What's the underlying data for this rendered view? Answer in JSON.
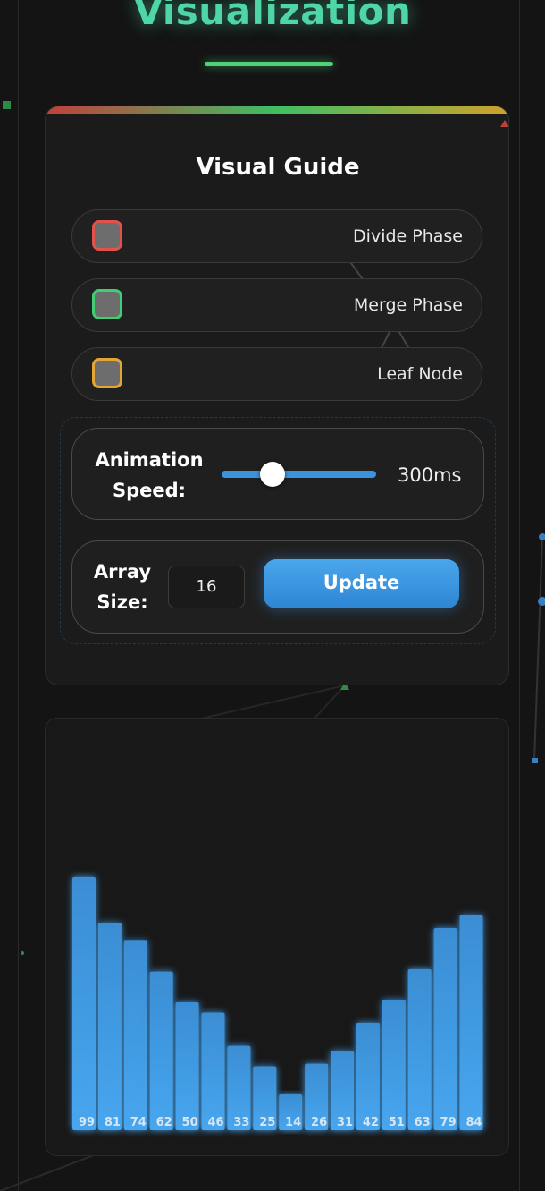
{
  "page": {
    "title": "Visualization"
  },
  "guide": {
    "title": "Visual Guide",
    "legend": [
      {
        "label": "Divide Phase",
        "color": "#e0524b"
      },
      {
        "label": "Merge Phase",
        "color": "#3fcf72"
      },
      {
        "label": "Leaf Node",
        "color": "#e3a534"
      }
    ]
  },
  "controls": {
    "speed": {
      "label_line1": "Animation",
      "label_line2": "Speed:",
      "value_text": "300ms",
      "value_ms": 300
    },
    "size": {
      "label_line1": "Array",
      "label_line2": "Size:",
      "value": "16",
      "button_label": "Update"
    }
  },
  "colors": {
    "accent": "#3a93dd",
    "title": "#4fd6a6"
  },
  "chart_data": {
    "type": "bar",
    "values": [
      99,
      81,
      74,
      62,
      50,
      46,
      33,
      25,
      14,
      26,
      31,
      42,
      51,
      63,
      79,
      84
    ],
    "color": "#3a93dd"
  }
}
